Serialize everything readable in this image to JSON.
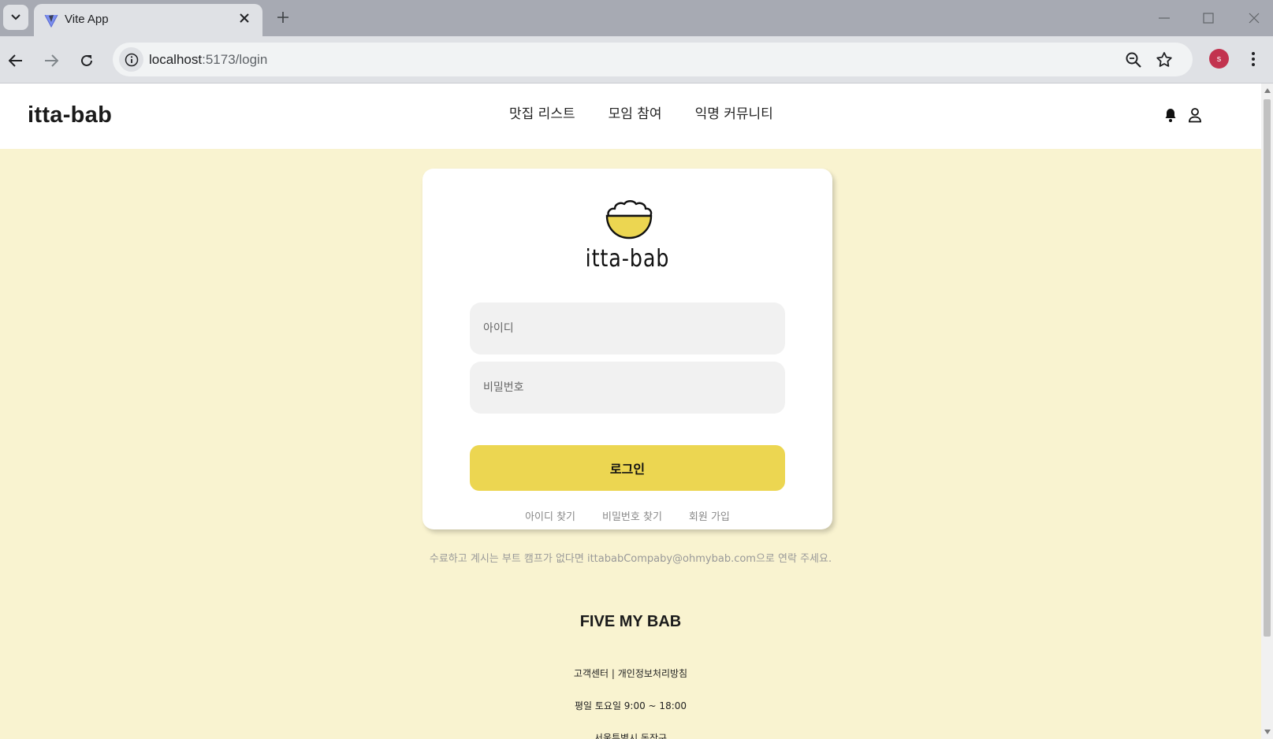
{
  "browser": {
    "tab_title": "Vite App",
    "url_host": "localhost",
    "url_path": ":5173/login",
    "profile_initial": "s",
    "profile_color": "#c2334f"
  },
  "header": {
    "brand": "itta-bab",
    "nav": [
      "맛집 리스트",
      "모임 참여",
      "익명 커뮤니티"
    ]
  },
  "login": {
    "logo_text": "itta-bab",
    "id_placeholder": "아이디",
    "pw_placeholder": "비밀번호",
    "submit_label": "로그인",
    "links": [
      "아이디 찾기",
      "비밀번호 찾기",
      "회원 가입"
    ]
  },
  "contact_note": "수료하고 계시는 부트 캠프가 없다면 ittababCompaby@ohmybab.com으로 연락 주세요.",
  "footer": {
    "title": "FIVE MY BAB",
    "lines": [
      "고객센터 | 개인정보처리방침",
      "평일 토요일 9:00 ~ 18:00",
      "서울특별시 동작구"
    ]
  },
  "colors": {
    "page_bg": "#f9f3d0",
    "accent": "#ecd651"
  }
}
